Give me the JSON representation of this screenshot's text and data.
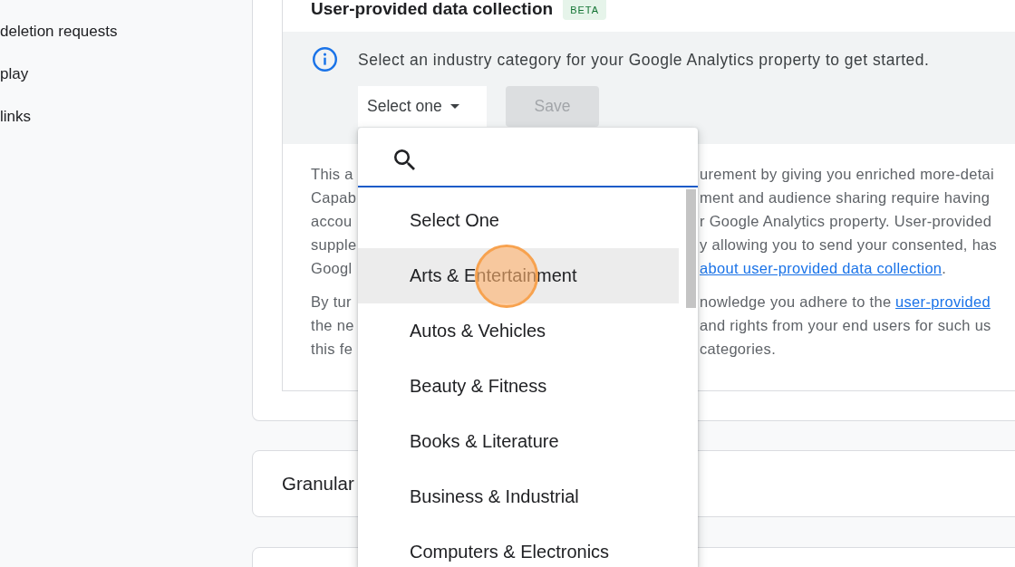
{
  "sidebar": {
    "items": [
      {
        "label": "deletion requests"
      },
      {
        "label": "play"
      },
      {
        "label": "links"
      }
    ]
  },
  "data_collection_card": {
    "title": "User-provided data collection",
    "badge": "BETA",
    "notice": {
      "text": "Select an industry category for your Google Analytics property to get started.",
      "industry_select": {
        "value": "Select one"
      },
      "save_button": {
        "label": "Save",
        "disabled": true
      }
    },
    "paragraphs": [
      {
        "lines": [
          {
            "left": "This a",
            "right": [
              {
                "kind": "text",
                "text": "urement by giving you enriched more-detai"
              }
            ]
          },
          {
            "left": "Capab",
            "right": [
              {
                "kind": "text",
                "text": "ment and audience sharing require having"
              }
            ]
          },
          {
            "left": "accou",
            "right": [
              {
                "kind": "text",
                "text": "r Google Analytics property. User-provided"
              }
            ]
          },
          {
            "left": "supple",
            "right": [
              {
                "kind": "text",
                "text": "y allowing you to send your consented, has"
              }
            ]
          },
          {
            "left": "Googl",
            "right": [
              {
                "kind": "link",
                "text": "about user-provided data collection"
              },
              {
                "kind": "text",
                "text": "."
              }
            ]
          }
        ]
      },
      {
        "lines": [
          {
            "left": "By tur",
            "right": [
              {
                "kind": "text",
                "text": "nowledge you adhere to the"
              },
              {
                "kind": "link",
                "text": "user-provided"
              }
            ]
          },
          {
            "left": "the ne",
            "right": [
              {
                "kind": "text",
                "text": "and rights from your end users for such us"
              }
            ]
          },
          {
            "left": "this fe",
            "right": [
              {
                "kind": "text",
                "text": "categories."
              }
            ]
          }
        ]
      }
    ]
  },
  "granular_card": {
    "title": "Granular"
  },
  "industry_menu": {
    "search_field": {
      "focused": true
    },
    "options": [
      {
        "label": "Select One",
        "selected": false
      },
      {
        "label": "Arts & Entertainment",
        "selected": true
      },
      {
        "label": "Autos & Vehicles",
        "selected": false
      },
      {
        "label": "Beauty & Fitness",
        "selected": false
      },
      {
        "label": "Books & Literature",
        "selected": false
      },
      {
        "label": "Business & Industrial",
        "selected": false
      },
      {
        "label": "Computers & Electronics",
        "selected": false
      }
    ]
  }
}
